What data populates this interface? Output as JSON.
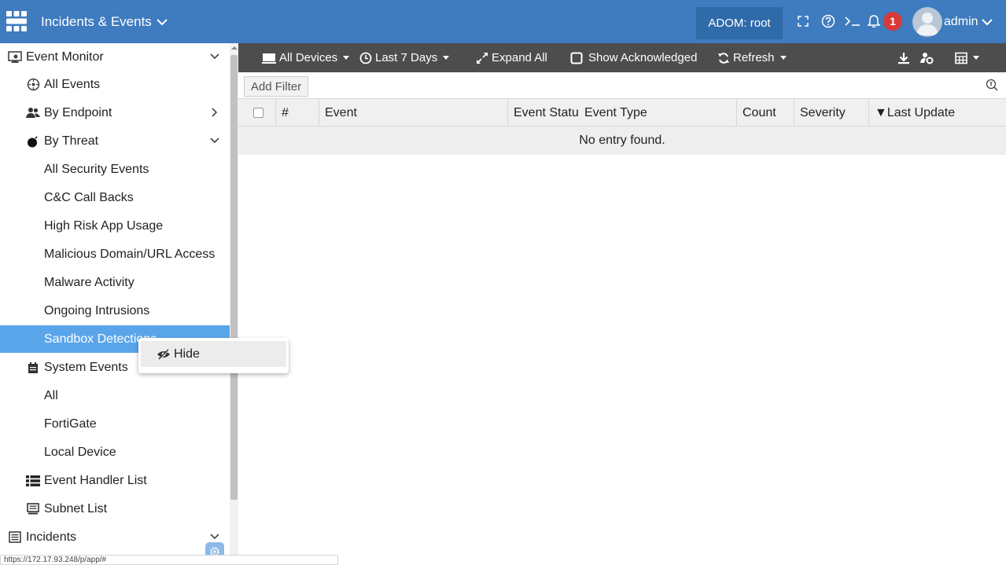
{
  "topbar": {
    "app_title": "Incidents & Events",
    "adom": "ADOM: root",
    "notification_count": "1",
    "user": "admin",
    "colors": {
      "bar": "#3e7bbf",
      "badge": "#d83a3a"
    }
  },
  "sidebar": {
    "items": [
      {
        "label": "Event Monitor",
        "icon": "event-monitor-icon"
      },
      {
        "label": "All Events",
        "icon": "all-events-icon"
      },
      {
        "label": "By Endpoint",
        "icon": "users-icon"
      },
      {
        "label": "By Threat",
        "icon": "bomb-icon"
      },
      {
        "label": "All Security Events"
      },
      {
        "label": "C&C Call Backs"
      },
      {
        "label": "High Risk App Usage"
      },
      {
        "label": "Malicious Domain/URL Access"
      },
      {
        "label": "Malware Activity"
      },
      {
        "label": "Ongoing Intrusions"
      },
      {
        "label": "Sandbox Detections"
      },
      {
        "label": "System Events",
        "icon": "system-events-icon"
      },
      {
        "label": "All"
      },
      {
        "label": "FortiGate"
      },
      {
        "label": "Local Device"
      },
      {
        "label": "Event Handler List",
        "icon": "list-icon"
      },
      {
        "label": "Subnet List",
        "icon": "subnet-icon"
      },
      {
        "label": "Incidents",
        "icon": "incidents-icon"
      }
    ],
    "selected_color": "#5aa5ea"
  },
  "toolbar": {
    "devices": "All Devices",
    "time_range": "Last 7 Days",
    "expand": "Expand All",
    "show_ack": "Show Acknowledged",
    "refresh": "Refresh"
  },
  "filter": {
    "add_filter": "Add Filter"
  },
  "table": {
    "columns": [
      "#",
      "Event",
      "Event Status",
      "Event Type",
      "Count",
      "Severity",
      "▼Last Update"
    ],
    "empty_message": "No entry found."
  },
  "context_menu": {
    "hide": "Hide"
  },
  "statusbar": {
    "url": "https://172.17.93.248/p/app/#"
  }
}
